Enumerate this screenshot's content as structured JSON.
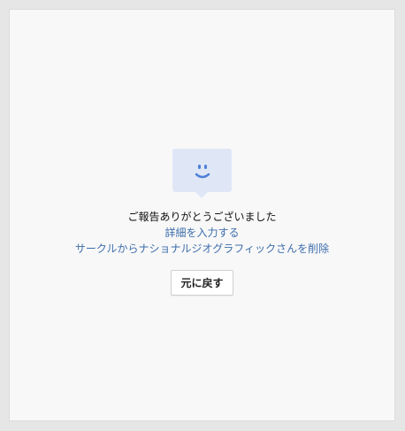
{
  "feedback": {
    "icon": "smiley-speech-bubble-icon",
    "title": "ご報告ありがとうございました",
    "details_link": "詳細を入力する",
    "remove_link": "サークルからナショナルジオグラフィックさんを削除",
    "undo_button": "元に戻す"
  },
  "colors": {
    "link": "#3d6eab",
    "icon_bg": "#dfe7f7",
    "icon_face": "#4f80d6"
  }
}
